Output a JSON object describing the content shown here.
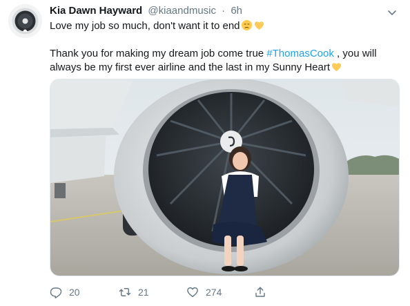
{
  "tweet": {
    "author_name": "Kia Dawn Hayward",
    "author_handle": "@kiaandmusic",
    "separator": "·",
    "time": "6h",
    "line1": "Love my job so much, don't want it to end",
    "line1_emojis": [
      "pensive-face",
      "yellow-heart"
    ],
    "line2_before": "Thank you for making my dream job come true ",
    "hashtag": "#ThomasCook",
    "line2_after": " , you will always be my first ever airline and the last in my Sunny Heart",
    "line2_emoji": "yellow-heart"
  },
  "media": {
    "description_icon": "photo-woman-sitting-in-jet-engine"
  },
  "actions": {
    "reply_count": "20",
    "retweet_count": "21",
    "like_count": "274",
    "reply_icon": "reply-icon",
    "retweet_icon": "retweet-icon",
    "like_icon": "heart-icon",
    "share_icon": "share-icon"
  },
  "colors": {
    "link": "#1da1f2",
    "muted": "#657786",
    "text": "#14171a"
  }
}
